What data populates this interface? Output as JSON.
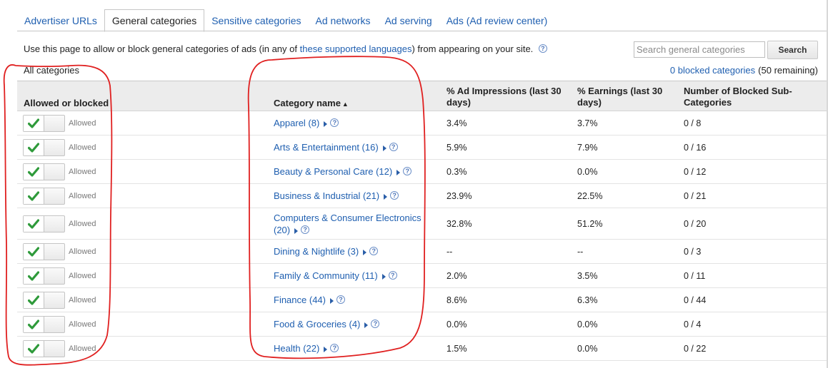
{
  "tabs": [
    {
      "label": "Advertiser URLs",
      "active": false
    },
    {
      "label": "General categories",
      "active": true
    },
    {
      "label": "Sensitive categories",
      "active": false
    },
    {
      "label": "Ad networks",
      "active": false
    },
    {
      "label": "Ad serving",
      "active": false
    },
    {
      "label": "Ads (Ad review center)",
      "active": false
    }
  ],
  "intro": {
    "before": "Use this page to allow or block general categories of ads (in any of",
    "link": "these supported languages",
    "after": ") from appearing on your site."
  },
  "search": {
    "placeholder": "Search general categories",
    "value": "",
    "button": "Search"
  },
  "all_categories": "All categories",
  "blocked_summary": {
    "link": "0 blocked categories",
    "remaining": "(50 remaining)"
  },
  "table": {
    "headers": {
      "allowed": "Allowed or blocked",
      "name": "Category name",
      "impressions": "% Ad Impressions (last 30 days)",
      "earnings": "% Earnings (last 30 days)",
      "sub": "Number of Blocked Sub-Categories"
    },
    "rows": [
      {
        "state": "Allowed",
        "name": "Apparel (8)",
        "impressions": "3.4%",
        "earnings": "3.7%",
        "sub": "0 / 8"
      },
      {
        "state": "Allowed",
        "name": "Arts & Entertainment (16)",
        "impressions": "5.9%",
        "earnings": "7.9%",
        "sub": "0 / 16"
      },
      {
        "state": "Allowed",
        "name": "Beauty & Personal Care (12)",
        "impressions": "0.3%",
        "earnings": "0.0%",
        "sub": "0 / 12"
      },
      {
        "state": "Allowed",
        "name": "Business & Industrial (21)",
        "impressions": "23.9%",
        "earnings": "22.5%",
        "sub": "0 / 21"
      },
      {
        "state": "Allowed",
        "name": "Computers & Consumer Electronics (20)",
        "impressions": "32.8%",
        "earnings": "51.2%",
        "sub": "0 / 20"
      },
      {
        "state": "Allowed",
        "name": "Dining & Nightlife (3)",
        "impressions": "--",
        "earnings": "--",
        "sub": "0 / 3"
      },
      {
        "state": "Allowed",
        "name": "Family & Community (11)",
        "impressions": "2.0%",
        "earnings": "3.5%",
        "sub": "0 / 11"
      },
      {
        "state": "Allowed",
        "name": "Finance (44)",
        "impressions": "8.6%",
        "earnings": "6.3%",
        "sub": "0 / 44"
      },
      {
        "state": "Allowed",
        "name": "Food & Groceries (4)",
        "impressions": "0.0%",
        "earnings": "0.0%",
        "sub": "0 / 4"
      },
      {
        "state": "Allowed",
        "name": "Health (22)",
        "impressions": "1.5%",
        "earnings": "0.0%",
        "sub": "0 / 22"
      }
    ]
  },
  "colors": {
    "link": "#1f5fb0",
    "check": "#2e9a3a",
    "annotation": "#e02020",
    "header_bg": "#ececec"
  },
  "icons": {
    "help": "help-circle-icon",
    "check": "checkmark-icon",
    "expand": "expand-triangle-icon",
    "sort": "sort-ascending-icon"
  }
}
